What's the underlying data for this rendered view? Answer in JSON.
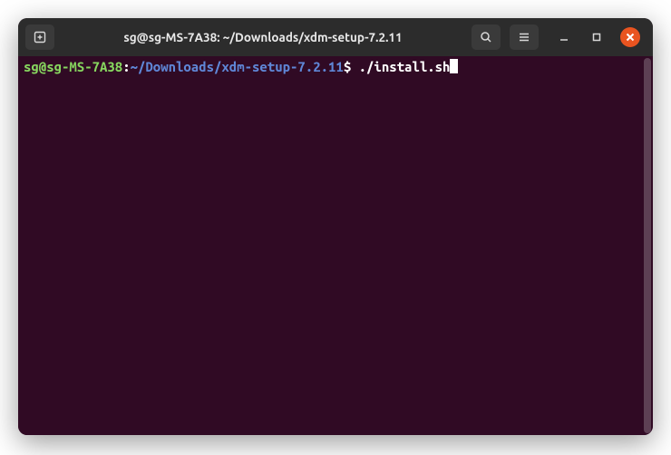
{
  "window": {
    "title": "sg@sg-MS-7A38: ~/Downloads/xdm-setup-7.2.11"
  },
  "prompt": {
    "userhost": "sg@sg-MS-7A38",
    "colon": ":",
    "path": "~/Downloads/xdm-setup-7.2.11",
    "dollar": "$ ",
    "command": "./install.sh"
  },
  "icons": {
    "new_tab": "new-tab",
    "search": "search",
    "menu": "menu",
    "minimize": "minimize",
    "maximize": "maximize",
    "close": "close"
  }
}
